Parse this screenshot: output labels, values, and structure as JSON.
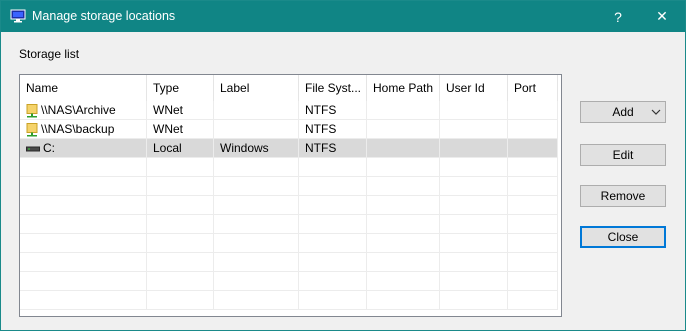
{
  "window": {
    "title": "Manage storage locations",
    "help_glyph": "?",
    "close_glyph": "✕"
  },
  "storage": {
    "label": "Storage list",
    "columns": [
      "Name",
      "Type",
      "Label",
      "File Syst...",
      "Home Path",
      "User Id",
      "Port"
    ],
    "rows": [
      {
        "name": "\\\\NAS\\Archive",
        "type": "WNet",
        "label": "",
        "fs": "NTFS",
        "home": "",
        "user": "",
        "port": "",
        "icon": "network-share-icon",
        "selected": false
      },
      {
        "name": "\\\\NAS\\backup",
        "type": "WNet",
        "label": "",
        "fs": "NTFS",
        "home": "",
        "user": "",
        "port": "",
        "icon": "network-share-icon",
        "selected": false
      },
      {
        "name": "C:",
        "type": "Local",
        "label": "Windows",
        "fs": "NTFS",
        "home": "",
        "user": "",
        "port": "",
        "icon": "drive-icon",
        "selected": true
      }
    ]
  },
  "buttons": {
    "add": "Add",
    "edit": "Edit",
    "remove": "Remove",
    "close": "Close"
  },
  "colors": {
    "titlebar": "#108585",
    "selected_row": "#d9d9d9",
    "default_button_border": "#0078d7"
  }
}
